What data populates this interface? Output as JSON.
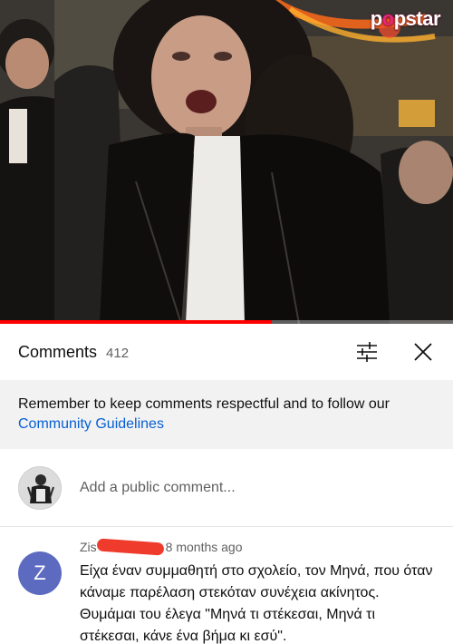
{
  "video": {
    "watermark": {
      "prefix": "p",
      "highlight": "o",
      "rest": "pstar"
    },
    "progress_fraction": 0.6
  },
  "comments_panel": {
    "title": "Comments",
    "count": "412",
    "icons": {
      "sort": "sort-filter-icon",
      "close": "close-icon"
    }
  },
  "notice": {
    "text": "Remember to keep comments respectful and to follow our",
    "link": "Community Guidelines"
  },
  "add_comment": {
    "placeholder": "Add a public comment..."
  },
  "comments": [
    {
      "avatar_letter": "Z",
      "author_visible": "Zis",
      "time": "8 months ago",
      "text": "Είχα έναν συμμαθητή στο σχολείο, τον Μηνά, που όταν κάναμε παρέλαση στεκόταν συνέχεια ακίνητος. Θυμάμαι του έλεγα \"Μηνά τι στέκεσαι, Μηνά τι στέκεσαι, κάνε ένα βήμα κι εσύ\"."
    }
  ],
  "colors": {
    "accent_red": "#ff0000",
    "link_blue": "#065fd4",
    "avatar_z": "#5c6bc0",
    "notice_bg": "#f2f2f2"
  }
}
